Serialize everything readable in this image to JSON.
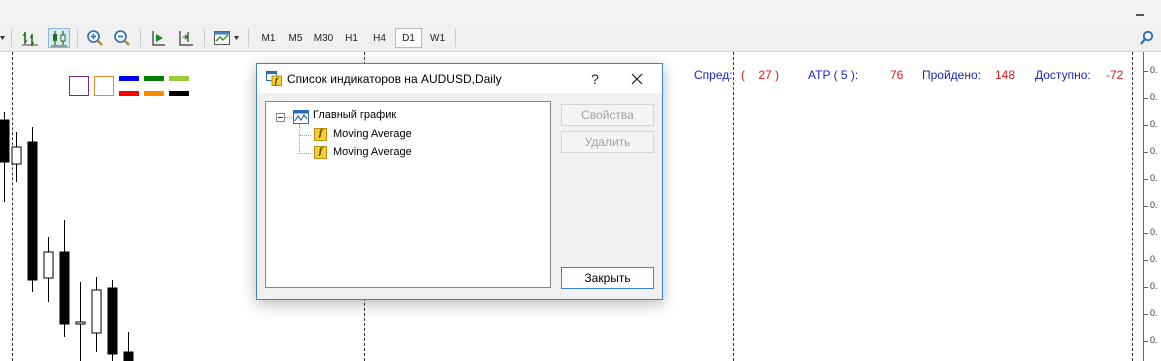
{
  "window": {
    "minimize_icon": "minimize-icon"
  },
  "toolbar": {
    "icons": [
      "bar-chart-icon",
      "candlestick-icon",
      "zoom-in-icon",
      "zoom-out-icon",
      "auto-scroll-icon",
      "chart-shift-icon",
      "templates-icon"
    ],
    "timeframes": [
      "M1",
      "M5",
      "M30",
      "H1",
      "H4",
      "D1",
      "W1"
    ],
    "active_timeframe": "D1",
    "search_icon": "search-icon"
  },
  "chart": {
    "bull_color": "#ffffff",
    "bear_color": "#000000",
    "swatches": {
      "boxes": [
        "#7b2d8e",
        "#e08a2a"
      ],
      "lines_top": [
        "#0000ff",
        "#008000",
        "#9acd32"
      ],
      "lines_bottom": [
        "#ff0000",
        "#ff8c00",
        "#000000"
      ]
    },
    "info": {
      "spread_label": "Спред:",
      "spread_value": "(    27 )",
      "atr_label": "ATP ( 5 ):",
      "atr_value": "76",
      "passed_label": "Пройдено:",
      "passed_value": "148",
      "available_label": "Доступно:",
      "available_value": "-72"
    },
    "price_labels": [
      "0.",
      "0.",
      "0.",
      "0.",
      "0.",
      "0.",
      "0.",
      "0.",
      "0.",
      "0.",
      "0."
    ]
  },
  "dialog": {
    "title": "Список индикаторов на AUDUSD,Daily",
    "help_label": "?",
    "tree": {
      "root_label": "Главный график",
      "children": [
        "Moving Average",
        "Moving Average"
      ]
    },
    "buttons": {
      "properties": "Свойства",
      "delete": "Удалить",
      "close": "Закрыть"
    },
    "colors": {
      "accent": "#3a86d6"
    }
  }
}
